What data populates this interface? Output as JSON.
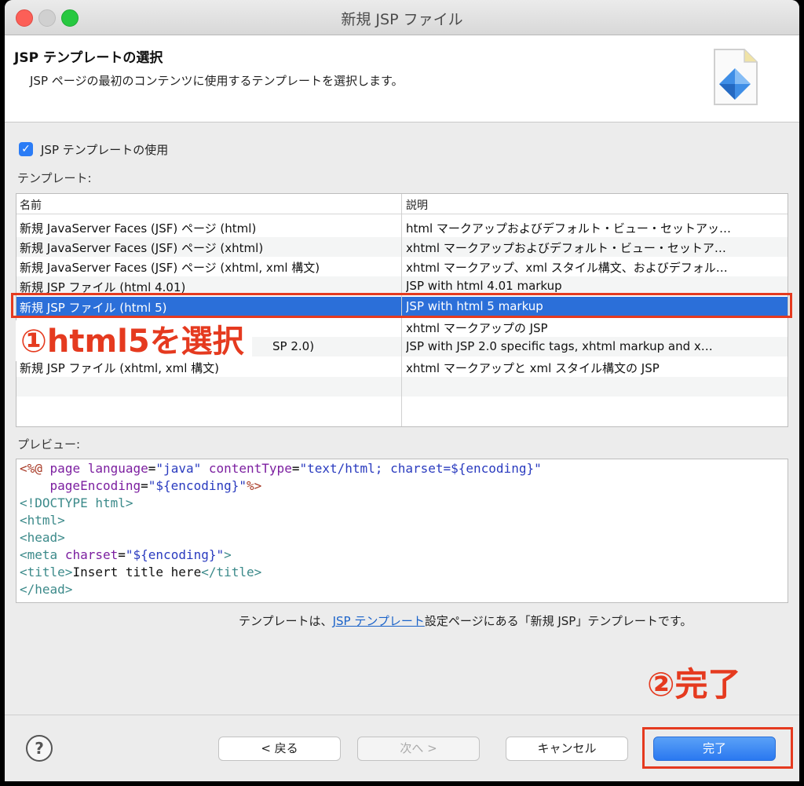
{
  "window": {
    "title": "新規 JSP ファイル"
  },
  "header": {
    "title": "JSP テンプレートの選択",
    "description": "JSP ページの最初のコンテンツに使用するテンプレートを選択します。"
  },
  "use_template": {
    "label": "JSP テンプレートの使用",
    "checked": true
  },
  "templates_label": "テンプレート:",
  "table": {
    "columns": [
      "名前",
      "説明"
    ],
    "rows": [
      {
        "name": "新規 JavaServer Faces (JSF) ページ (html)",
        "desc": "html マークアップおよびデフォルト・ビュー・セットアッ…"
      },
      {
        "name": "新規 JavaServer Faces (JSF) ページ (xhtml)",
        "desc": "xhtml マークアップおよびデフォルト・ビュー・セットア…"
      },
      {
        "name": "新規 JavaServer Faces (JSF) ページ (xhtml, xml 構文)",
        "desc": "xhtml マークアップ、xml スタイル構文、およびデフォル…"
      },
      {
        "name": "新規 JSP ファイル (html 4.01)",
        "desc": "JSP with html 4.01 markup"
      },
      {
        "name": "新規 JSP ファイル (html 5)",
        "desc": "JSP with html 5 markup",
        "selected": true
      },
      {
        "name": "",
        "desc": "xhtml マークアップの JSP"
      },
      {
        "name": "SP 2.0)",
        "desc": "JSP with JSP 2.0 specific tags, xhtml markup and x…"
      },
      {
        "name": "新規 JSP ファイル (xhtml, xml 構文)",
        "desc": "xhtml マークアップと xml スタイル構文の JSP"
      }
    ]
  },
  "annotations": {
    "step1": "①html5を選択",
    "step2": "②完了"
  },
  "preview_label": "プレビュー:",
  "footer": {
    "before": "テンプレートは、",
    "link": "JSP テンプレート",
    "after": "設定ページにある「新規 JSP」テンプレートです。"
  },
  "buttons": {
    "back": "< 戻る",
    "next": "次へ >",
    "cancel": "キャンセル",
    "finish": "完了"
  },
  "colors": {
    "annotation": "#e53a1f",
    "selection": "#2b6fd9",
    "primary": "#2a78f0"
  }
}
